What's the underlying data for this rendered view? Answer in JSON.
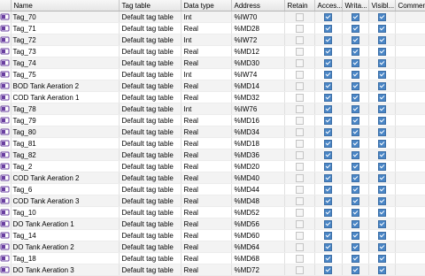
{
  "columns": [
    "Name",
    "Tag table",
    "Data type",
    "Address",
    "Retain",
    "Acces...",
    "Writa...",
    "Visibl...",
    "Comment"
  ],
  "rows": [
    {
      "name": "Tag_70",
      "table": "Default tag table",
      "type": "Int",
      "address": "%IW70"
    },
    {
      "name": "Tag_71",
      "table": "Default tag table",
      "type": "Real",
      "address": "%MD28"
    },
    {
      "name": "Tag_72",
      "table": "Default tag table",
      "type": "Int",
      "address": "%IW72"
    },
    {
      "name": "Tag_73",
      "table": "Default tag table",
      "type": "Real",
      "address": "%MD12"
    },
    {
      "name": "Tag_74",
      "table": "Default tag table",
      "type": "Real",
      "address": "%MD30"
    },
    {
      "name": "Tag_75",
      "table": "Default tag table",
      "type": "Int",
      "address": "%IW74"
    },
    {
      "name": "BOD Tank Aeration 2",
      "table": "Default tag table",
      "type": "Real",
      "address": "%MD14"
    },
    {
      "name": "COD Tank Aeration 1",
      "table": "Default tag table",
      "type": "Real",
      "address": "%MD32"
    },
    {
      "name": "Tag_78",
      "table": "Default tag table",
      "type": "Int",
      "address": "%IW76"
    },
    {
      "name": "Tag_79",
      "table": "Default tag table",
      "type": "Real",
      "address": "%MD16"
    },
    {
      "name": "Tag_80",
      "table": "Default tag table",
      "type": "Real",
      "address": "%MD34"
    },
    {
      "name": "Tag_81",
      "table": "Default tag table",
      "type": "Real",
      "address": "%MD18"
    },
    {
      "name": "Tag_82",
      "table": "Default tag table",
      "type": "Real",
      "address": "%MD36"
    },
    {
      "name": "Tag_2",
      "table": "Default tag table",
      "type": "Real",
      "address": "%MD20"
    },
    {
      "name": "COD Tank Aeration 2",
      "table": "Default tag table",
      "type": "Real",
      "address": "%MD40"
    },
    {
      "name": "Tag_6",
      "table": "Default tag table",
      "type": "Real",
      "address": "%MD44"
    },
    {
      "name": "COD Tank Aeration 3",
      "table": "Default tag table",
      "type": "Real",
      "address": "%MD48"
    },
    {
      "name": "Tag_10",
      "table": "Default tag table",
      "type": "Real",
      "address": "%MD52"
    },
    {
      "name": "DO Tank Aeration 1",
      "table": "Default tag table",
      "type": "Real",
      "address": "%MD56"
    },
    {
      "name": "Tag_14",
      "table": "Default tag table",
      "type": "Real",
      "address": "%MD60"
    },
    {
      "name": "DO Tank Aeration 2",
      "table": "Default tag table",
      "type": "Real",
      "address": "%MD64"
    },
    {
      "name": "Tag_18",
      "table": "Default tag table",
      "type": "Real",
      "address": "%MD68"
    },
    {
      "name": "DO Tank Aeration 3",
      "table": "Default tag table",
      "type": "Real",
      "address": "%MD72"
    }
  ],
  "retain_checked": false,
  "accessible_checked": true,
  "writable_checked": true,
  "visible_checked": true,
  "colors": {
    "tag_icon": "#6a3fa0",
    "checkbox": "#4a86c6"
  },
  "icons": {
    "row_icon": "tag-icon"
  }
}
